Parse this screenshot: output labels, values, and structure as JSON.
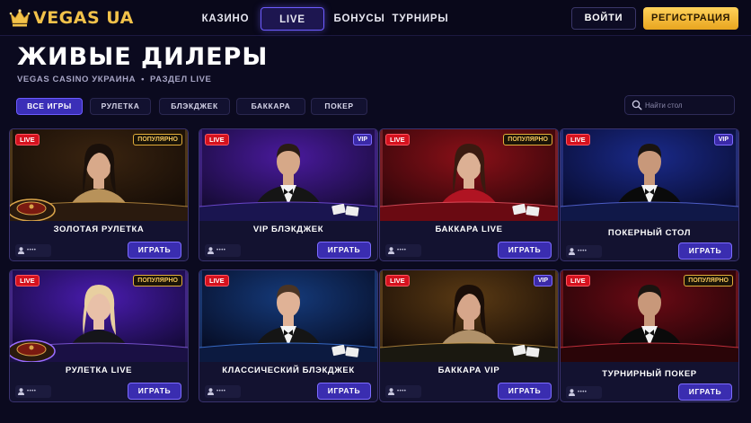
{
  "brand": {
    "name": "VEGAS UA",
    "gold": "#f2c24a"
  },
  "nav": {
    "casino": "КАЗИНО",
    "live": "LIVE",
    "bonuses": "БОНУСЫ",
    "tournaments": "ТУРНИРЫ"
  },
  "auth": {
    "login": "ВОЙТИ",
    "register": "РЕГИСТРАЦИЯ"
  },
  "page": {
    "title": "ЖИВЫЕ ДИЛЕРЫ",
    "breadcrumb_site": "VEGAS CASINO УКРАИНА",
    "breadcrumb_sep": "•",
    "breadcrumb_section": "РАЗДЕЛ LIVE"
  },
  "filters": {
    "all": "ВСЕ ИГРЫ",
    "roulette": "РУЛЕТКА",
    "blackjack": "БЛЭКДЖЕК",
    "baccarat": "БАККАРА",
    "poker": "ПОКЕР",
    "active": "ВСЕ ИГРЫ"
  },
  "search": {
    "placeholder": "Найти стол"
  },
  "colors": {
    "accent": "#6d5cff",
    "live_red": "#d5121e",
    "popular_gold": "#e2ad3a",
    "vip_purple": "#3b2aa8",
    "background": "#0b0a1f"
  },
  "cards": [
    {
      "title": "ЗОЛОТАЯ РУЛЕТКА",
      "live": "LIVE",
      "tag": "ПОПУЛЯРНО",
      "tag_type": "popular",
      "viewers": "••••",
      "play": "ИГРАТЬ",
      "scene": "roulette-gold"
    },
    {
      "title": "VIP БЛЭКДЖЕК",
      "live": "LIVE",
      "tag": "VIP",
      "tag_type": "vip",
      "viewers": "••••",
      "play": "ИГРАТЬ",
      "scene": "blackjack-purple"
    },
    {
      "title": "БАККАРА LIVE",
      "live": "LIVE",
      "tag": "ПОПУЛЯРНО",
      "tag_type": "popular",
      "viewers": "••••",
      "play": "ИГРАТЬ",
      "scene": "baccarat-red"
    },
    {
      "title": "ПОКЕРНЫЙ СТОЛ",
      "live": "LIVE",
      "tag": "VIP",
      "tag_type": "vip",
      "viewers": "••••",
      "play": "ИГРАТЬ",
      "scene": "poker-blue"
    },
    {
      "title": "РУЛЕТКА LIVE",
      "live": "LIVE",
      "tag": "ПОПУЛЯРНО",
      "tag_type": "popular",
      "viewers": "••••",
      "play": "ИГРАТЬ",
      "scene": "roulette-purple"
    },
    {
      "title": "КЛАССИЧЕСКИЙ БЛЭКДЖЕК",
      "live": "LIVE",
      "tag": "",
      "tag_type": "none",
      "viewers": "••••",
      "play": "ИГРАТЬ",
      "scene": "blackjack-blue"
    },
    {
      "title": "БАККАРА VIP",
      "live": "LIVE",
      "tag": "VIP",
      "tag_type": "vip",
      "viewers": "••••",
      "play": "ИГРАТЬ",
      "scene": "baccarat-gold"
    },
    {
      "title": "ТУРНИРНЫЙ ПОКЕР",
      "live": "LIVE",
      "tag": "ПОПУЛЯРНО",
      "tag_type": "popular",
      "viewers": "••••",
      "play": "ИГРАТЬ",
      "scene": "poker-red"
    }
  ]
}
